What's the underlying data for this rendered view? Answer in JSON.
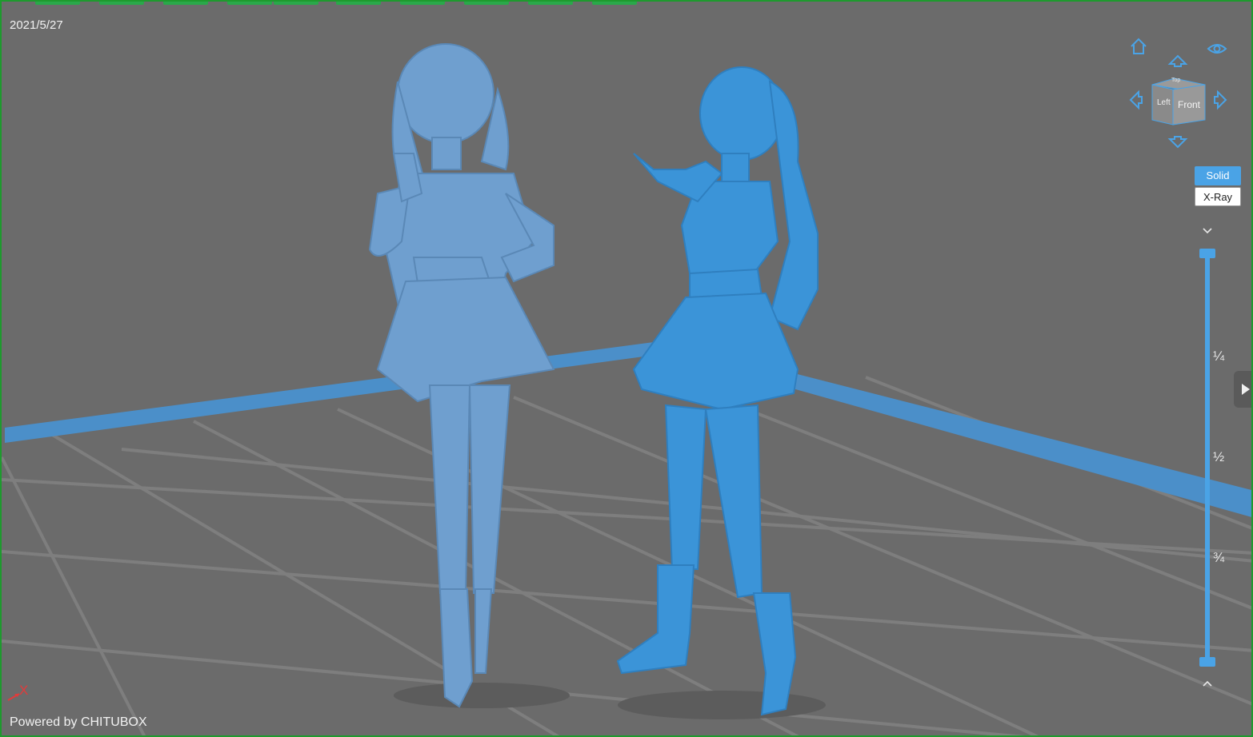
{
  "viewport": {
    "date": "2021/5/27",
    "powered_by": "Powered by CHITUBOX",
    "axis_label": "X"
  },
  "navcube": {
    "face_front": "Front",
    "face_left": "Left",
    "face_top": "Top"
  },
  "render_modes": {
    "solid": "Solid",
    "xray": "X-Ray",
    "selected": "Solid"
  },
  "layer_slider": {
    "marks": [
      "¼",
      "½",
      "¾"
    ]
  },
  "colors": {
    "accent": "#4aa3e6",
    "model_left": "#6f9fcf",
    "model_right": "#3b94d8",
    "platform_edge": "#4b8fc9",
    "background": "#6b6b6b"
  }
}
